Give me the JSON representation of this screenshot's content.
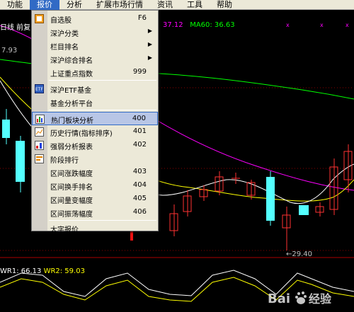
{
  "menubar": {
    "items": [
      {
        "label": "功能",
        "active": false
      },
      {
        "label": "报价",
        "active": true
      },
      {
        "label": "分析",
        "active": false
      },
      {
        "label": "扩展市场行情",
        "active": false
      },
      {
        "label": "资讯",
        "active": false
      },
      {
        "label": "工具",
        "active": false
      },
      {
        "label": "帮助",
        "active": false
      }
    ]
  },
  "chart": {
    "ticker_label": "日线 前复",
    "ma_fragment": "37.12",
    "ma60_label": "MA60: 36.63",
    "price_left": "7.93",
    "low_label": "←29.40",
    "wr1": "WR1: 66.13",
    "wr2": "WR2: 59.03",
    "colors": {
      "up": "#ff3232",
      "down": "#54ffff",
      "ma5": "#ffffff",
      "ma10": "#ffff00",
      "ma20": "#ff00ff",
      "ma60": "#00ff00",
      "wr1": "#ffffff",
      "wr2": "#ffff00"
    }
  },
  "dropdown": {
    "items": [
      {
        "label": "自选股",
        "key": "F6",
        "icon": "watchlist-icon"
      },
      {
        "label": "深沪分类",
        "submenu": true
      },
      {
        "label": "栏目排名",
        "submenu": true
      },
      {
        "label": "深沪综合排名",
        "submenu": true
      },
      {
        "label": "上证重点指数",
        "key": "999"
      },
      {
        "label": "深沪ETF基金",
        "icon": "etf-icon"
      },
      {
        "label": "基金分析平台"
      },
      {
        "label": "热门板块分析",
        "key": "400",
        "icon": "hot-sector-icon",
        "highlighted": true
      },
      {
        "label": "历史行情(指标排序)",
        "key": "401",
        "icon": "history-icon"
      },
      {
        "label": "强弱分析报表",
        "key": "402",
        "icon": "strength-icon"
      },
      {
        "label": "阶段排行",
        "icon": "period-rank-icon"
      },
      {
        "label": "区间涨跌幅度",
        "key": "403"
      },
      {
        "label": "区间换手排名",
        "key": "404"
      },
      {
        "label": "区间量变幅度",
        "key": "405"
      },
      {
        "label": "区间振荡幅度",
        "key": "406"
      },
      {
        "label": "大字报价"
      }
    ]
  },
  "watermark": {
    "brand": "Bai",
    "brand2": "经验"
  }
}
